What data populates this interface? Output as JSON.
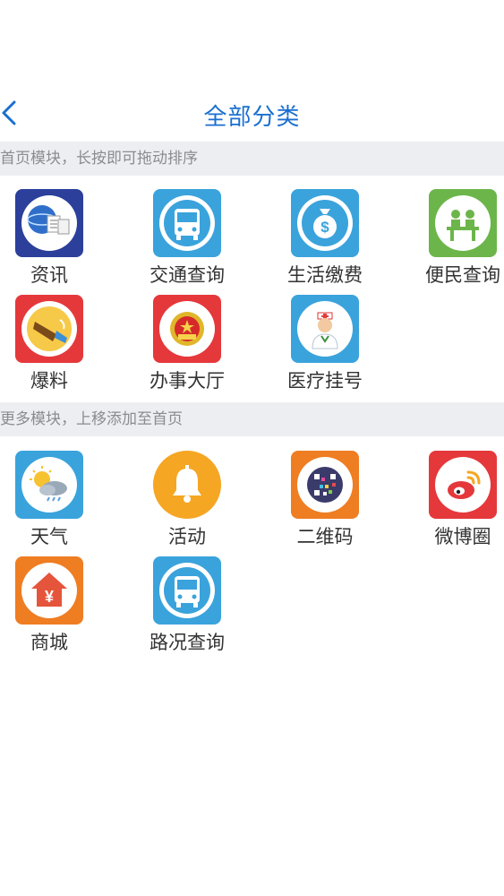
{
  "header": {
    "title": "全部分类"
  },
  "home_section": {
    "hint": "首页模块，长按即可拖动排序",
    "items": [
      {
        "label": "资讯",
        "icon": "news-icon",
        "color": "#2b3f9b"
      },
      {
        "label": "交通查询",
        "icon": "bus-icon",
        "color": "#3aa3dc"
      },
      {
        "label": "生活缴费",
        "icon": "money-bag-icon",
        "color": "#3aa3dc"
      },
      {
        "label": "便民查询",
        "icon": "service-counter-icon",
        "color": "#6cb54a"
      },
      {
        "label": "爆料",
        "icon": "megaphone-icon",
        "color": "#e5383b"
      },
      {
        "label": "办事大厅",
        "icon": "national-emblem-icon",
        "color": "#e5383b"
      },
      {
        "label": "医疗挂号",
        "icon": "nurse-icon",
        "color": "#3aa3dc"
      }
    ]
  },
  "more_section": {
    "hint": "更多模块，上移添加至首页",
    "items": [
      {
        "label": "天气",
        "icon": "weather-icon",
        "color": "#3aa3dc"
      },
      {
        "label": "活动",
        "icon": "bell-icon",
        "color": "#f5a623"
      },
      {
        "label": "二维码",
        "icon": "qr-code-icon",
        "color": "#ef7d22"
      },
      {
        "label": "微博圈",
        "icon": "weibo-icon",
        "color": "#e5383b"
      },
      {
        "label": "商城",
        "icon": "shop-house-icon",
        "color": "#ef7d22"
      },
      {
        "label": "路况查询",
        "icon": "bus-icon",
        "color": "#3aa3dc"
      }
    ]
  }
}
